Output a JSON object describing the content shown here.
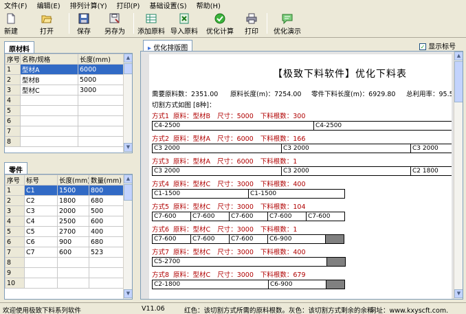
{
  "menu": [
    "文件(F)",
    "编辑(E)",
    "排列计算(Y)",
    "打印(P)",
    "基础设置(S)",
    "帮助(H)"
  ],
  "toolbar": {
    "new": "新建",
    "open": "打开",
    "save": "保存",
    "save_as": "另存为",
    "add_material": "添加原料",
    "import_material": "导入原料",
    "optimize": "优化计算",
    "print": "打印",
    "demo": "优化演示"
  },
  "raw_panel": {
    "tab": "原材料",
    "headers": [
      "序号",
      "名称/规格",
      "长度(mm)"
    ],
    "rows": [
      [
        "1",
        "型材A",
        "6000"
      ],
      [
        "2",
        "型材B",
        "5000"
      ],
      [
        "3",
        "型材C",
        "3000"
      ],
      [
        "4",
        "",
        ""
      ],
      [
        "5",
        "",
        ""
      ],
      [
        "6",
        "",
        ""
      ],
      [
        "7",
        "",
        ""
      ],
      [
        "8",
        "",
        ""
      ]
    ]
  },
  "parts_panel": {
    "tab": "零件",
    "headers": [
      "序号",
      "标号",
      "长度(mm)",
      "数量(mm)"
    ],
    "rows": [
      [
        "1",
        "C1",
        "1500",
        "800"
      ],
      [
        "2",
        "C2",
        "1800",
        "680"
      ],
      [
        "3",
        "C3",
        "2000",
        "500"
      ],
      [
        "4",
        "C4",
        "2500",
        "600"
      ],
      [
        "5",
        "C5",
        "2700",
        "400"
      ],
      [
        "6",
        "C6",
        "900",
        "680"
      ],
      [
        "7",
        "C7",
        "600",
        "523"
      ],
      [
        "8",
        "",
        "",
        ""
      ],
      [
        "9",
        "",
        "",
        ""
      ],
      [
        "10",
        "",
        "",
        ""
      ]
    ]
  },
  "report_tab": "优化排版图",
  "show_label": "显示标号",
  "report": {
    "title": "【极致下料软件】优化下料表",
    "stats": {
      "need": "需要原料数：2351.00",
      "raw_len": "原料长度(m)：7254.00",
      "part_len": "零件下料长度(m)：6929.80",
      "rate": "总利用率：95.5"
    },
    "scheme_title": "切割方式如图 [8种]：",
    "schemes": [
      {
        "label": "方式1",
        "mat": "原料：型材B",
        "size": "尺寸：5000",
        "count": "下料根数：300",
        "bars": [
          {
            "t": "C4-2500",
            "w": 236
          },
          {
            "t": "C4-2500",
            "w": 236
          }
        ],
        "waste": 0
      },
      {
        "label": "方式2",
        "mat": "原料：型材A",
        "size": "尺寸：6000",
        "count": "下料根数：166",
        "bars": [
          {
            "t": "C3 2000",
            "w": 189
          },
          {
            "t": "C3 2000",
            "w": 189
          },
          {
            "t": "C3 2000",
            "w": 70
          }
        ],
        "waste": 0
      },
      {
        "label": "方式3",
        "mat": "原料：型材A",
        "size": "尺寸：6000",
        "count": "下料根数：1",
        "bars": [
          {
            "t": "C3 2000",
            "w": 189
          },
          {
            "t": "C3 2000",
            "w": 189
          },
          {
            "t": "C2 1800",
            "w": 70
          }
        ],
        "waste": 0
      },
      {
        "label": "方式4",
        "mat": "原料：型材C",
        "size": "尺寸：3000",
        "count": "下料根数：400",
        "bars": [
          {
            "t": "C1-1500",
            "w": 141
          },
          {
            "t": "C1-1500",
            "w": 141
          }
        ],
        "waste": 0
      },
      {
        "label": "方式5",
        "mat": "原料：型材C",
        "size": "尺寸：3000",
        "count": "下料根数：104",
        "bars": [
          {
            "t": "C7-600",
            "w": 57
          },
          {
            "t": "C7-600",
            "w": 57
          },
          {
            "t": "C7-600",
            "w": 57
          },
          {
            "t": "C7-600",
            "w": 57
          },
          {
            "t": "C7-600",
            "w": 57
          }
        ],
        "waste": 0
      },
      {
        "label": "方式6",
        "mat": "原料：型材C",
        "size": "尺寸：3000",
        "count": "下料根数：1",
        "bars": [
          {
            "t": "C7-600",
            "w": 57
          },
          {
            "t": "C7-600",
            "w": 57
          },
          {
            "t": "C7-600",
            "w": 57
          },
          {
            "t": "C6-900",
            "w": 85
          }
        ],
        "waste": 28
      },
      {
        "label": "方式7",
        "mat": "原料：型材C",
        "size": "尺寸：3000",
        "count": "下料根数：400",
        "bars": [
          {
            "t": "C5-2700",
            "w": 255
          }
        ],
        "waste": 28
      },
      {
        "label": "方式8",
        "mat": "原料：型材C",
        "size": "尺寸：3000",
        "count": "下料根数：679",
        "bars": [
          {
            "t": "C2-1800",
            "w": 170
          },
          {
            "t": "C6-900",
            "w": 85
          }
        ],
        "waste": 28
      }
    ]
  },
  "status": {
    "welcome": "欢迎使用极致下料系列软件",
    "version": "V11.06",
    "legend": "红色：该切割方式所需的原料根数。灰色：该切割方式剩余的余料",
    "site": "网址：www.kxyscft.com."
  }
}
